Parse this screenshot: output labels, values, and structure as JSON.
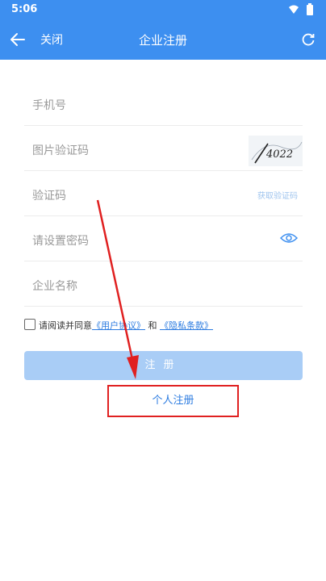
{
  "status": {
    "time": "5:06"
  },
  "appbar": {
    "close_label": "关闭",
    "title": "企业注册"
  },
  "form": {
    "phone_placeholder": "手机号",
    "image_code_placeholder": "图片验证码",
    "captcha_text": "4022",
    "sms_code_placeholder": "验证码",
    "get_code_label": "获取验证码",
    "password_placeholder": "请设置密码",
    "company_placeholder": "企业名称"
  },
  "agreement": {
    "prefix": "请阅读并同意",
    "user_agreement": "《用户协议》",
    "and": "和",
    "privacy": "《隐私条款》"
  },
  "actions": {
    "register_label": "注册",
    "personal_register_label": "个人注册"
  },
  "colors": {
    "primary": "#3d8ff0",
    "button_disabled": "#a9cdf6",
    "annotation": "#e02020"
  }
}
